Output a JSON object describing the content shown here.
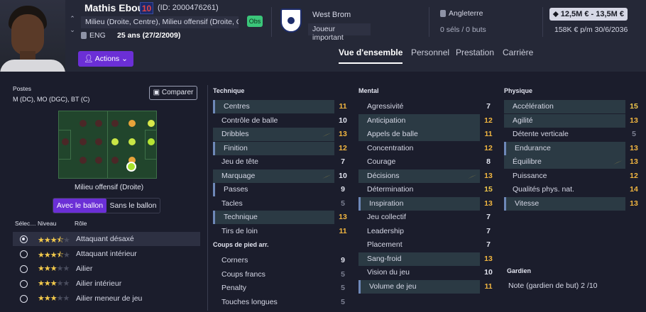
{
  "player": {
    "name": "Mathis Eboué",
    "number": "10",
    "id": "(ID: 2000476261)",
    "positions_line": "Milieu (Droite, Centre), Milieu offensif (Droite, Gau…",
    "obs": "Obs",
    "nationality": "ENG",
    "age": "25 ans (27/2/2009)"
  },
  "actions": "Actions",
  "club": {
    "name": "West Brom",
    "role": "Joueur important"
  },
  "intl": {
    "country": "Angleterre",
    "caps": "0 séls / 0 buts"
  },
  "contract": {
    "value": "12,5M € - 13,5M €",
    "wage": "158K € p/m 30/6/2036"
  },
  "tabs": [
    "Vue d'ensemble",
    "Personnel",
    "Prestation",
    "Carrière"
  ],
  "colors": {
    "accent": "#6b2fd6",
    "pitch": "#21452c",
    "gold": "#f2c94c",
    "good": "#a6e22e",
    "obs": "#3bc67a"
  },
  "left": {
    "postes_label": "Postes",
    "postes": "M (DC), MO (DGC), BT (C)",
    "compare": "Comparer",
    "role_caption": "Milieu offensif (Droite)",
    "seg_on": "Avec le ballon",
    "seg_off": "Sans le ballon",
    "h_sel": "Sélec…",
    "h_level": "Niveau",
    "h_role": "Rôle",
    "roles": [
      {
        "name": "Attaquant désaxé",
        "stars": 3.5,
        "sel": true
      },
      {
        "name": "Attaquant intérieur",
        "stars": 3.5,
        "sel": false
      },
      {
        "name": "Ailier",
        "stars": 3,
        "sel": false
      },
      {
        "name": "Ailier intérieur",
        "stars": 3,
        "sel": false
      },
      {
        "name": "Ailier meneur de jeu",
        "stars": 3,
        "sel": false
      }
    ]
  },
  "technique": {
    "title": "Technique",
    "rows": [
      [
        "Centres",
        "11"
      ],
      [
        "Contrôle de balle",
        "10"
      ],
      [
        "Dribbles",
        "13"
      ],
      [
        "Finition",
        "12"
      ],
      [
        "Jeu de tête",
        "7"
      ],
      [
        "Marquage",
        "10"
      ],
      [
        "Passes",
        "9"
      ],
      [
        "Tacles",
        "5"
      ],
      [
        "Technique",
        "13"
      ],
      [
        "Tirs de loin",
        "11"
      ]
    ]
  },
  "setpieces": {
    "title": "Coups de pied arr.",
    "rows": [
      [
        "Corners",
        "9"
      ],
      [
        "Coups francs",
        "5"
      ],
      [
        "Penalty",
        "5"
      ],
      [
        "Touches longues",
        "5"
      ]
    ]
  },
  "mental": {
    "title": "Mental",
    "rows": [
      [
        "Agressivité",
        "7"
      ],
      [
        "Anticipation",
        "12"
      ],
      [
        "Appels de balle",
        "11"
      ],
      [
        "Concentration",
        "12"
      ],
      [
        "Courage",
        "8"
      ],
      [
        "Décisions",
        "13"
      ],
      [
        "Détermination",
        "15"
      ],
      [
        "Inspiration",
        "13"
      ],
      [
        "Jeu collectif",
        "7"
      ],
      [
        "Leadership",
        "7"
      ],
      [
        "Placement",
        "7"
      ],
      [
        "Sang-froid",
        "13"
      ],
      [
        "Vision du jeu",
        "10"
      ],
      [
        "Volume de jeu",
        "11"
      ]
    ]
  },
  "physique": {
    "title": "Physique",
    "rows": [
      [
        "Accélération",
        "15"
      ],
      [
        "Agilité",
        "13"
      ],
      [
        "Détente verticale",
        "5"
      ],
      [
        "Endurance",
        "13"
      ],
      [
        "Équilibre",
        "13"
      ],
      [
        "Puissance",
        "12"
      ],
      [
        "Qualités phys. nat.",
        "14"
      ],
      [
        "Vitesse",
        "13"
      ]
    ]
  },
  "gardien": {
    "title": "Gardien",
    "note": "Note (gardien de but)",
    "value": "2 /10"
  }
}
